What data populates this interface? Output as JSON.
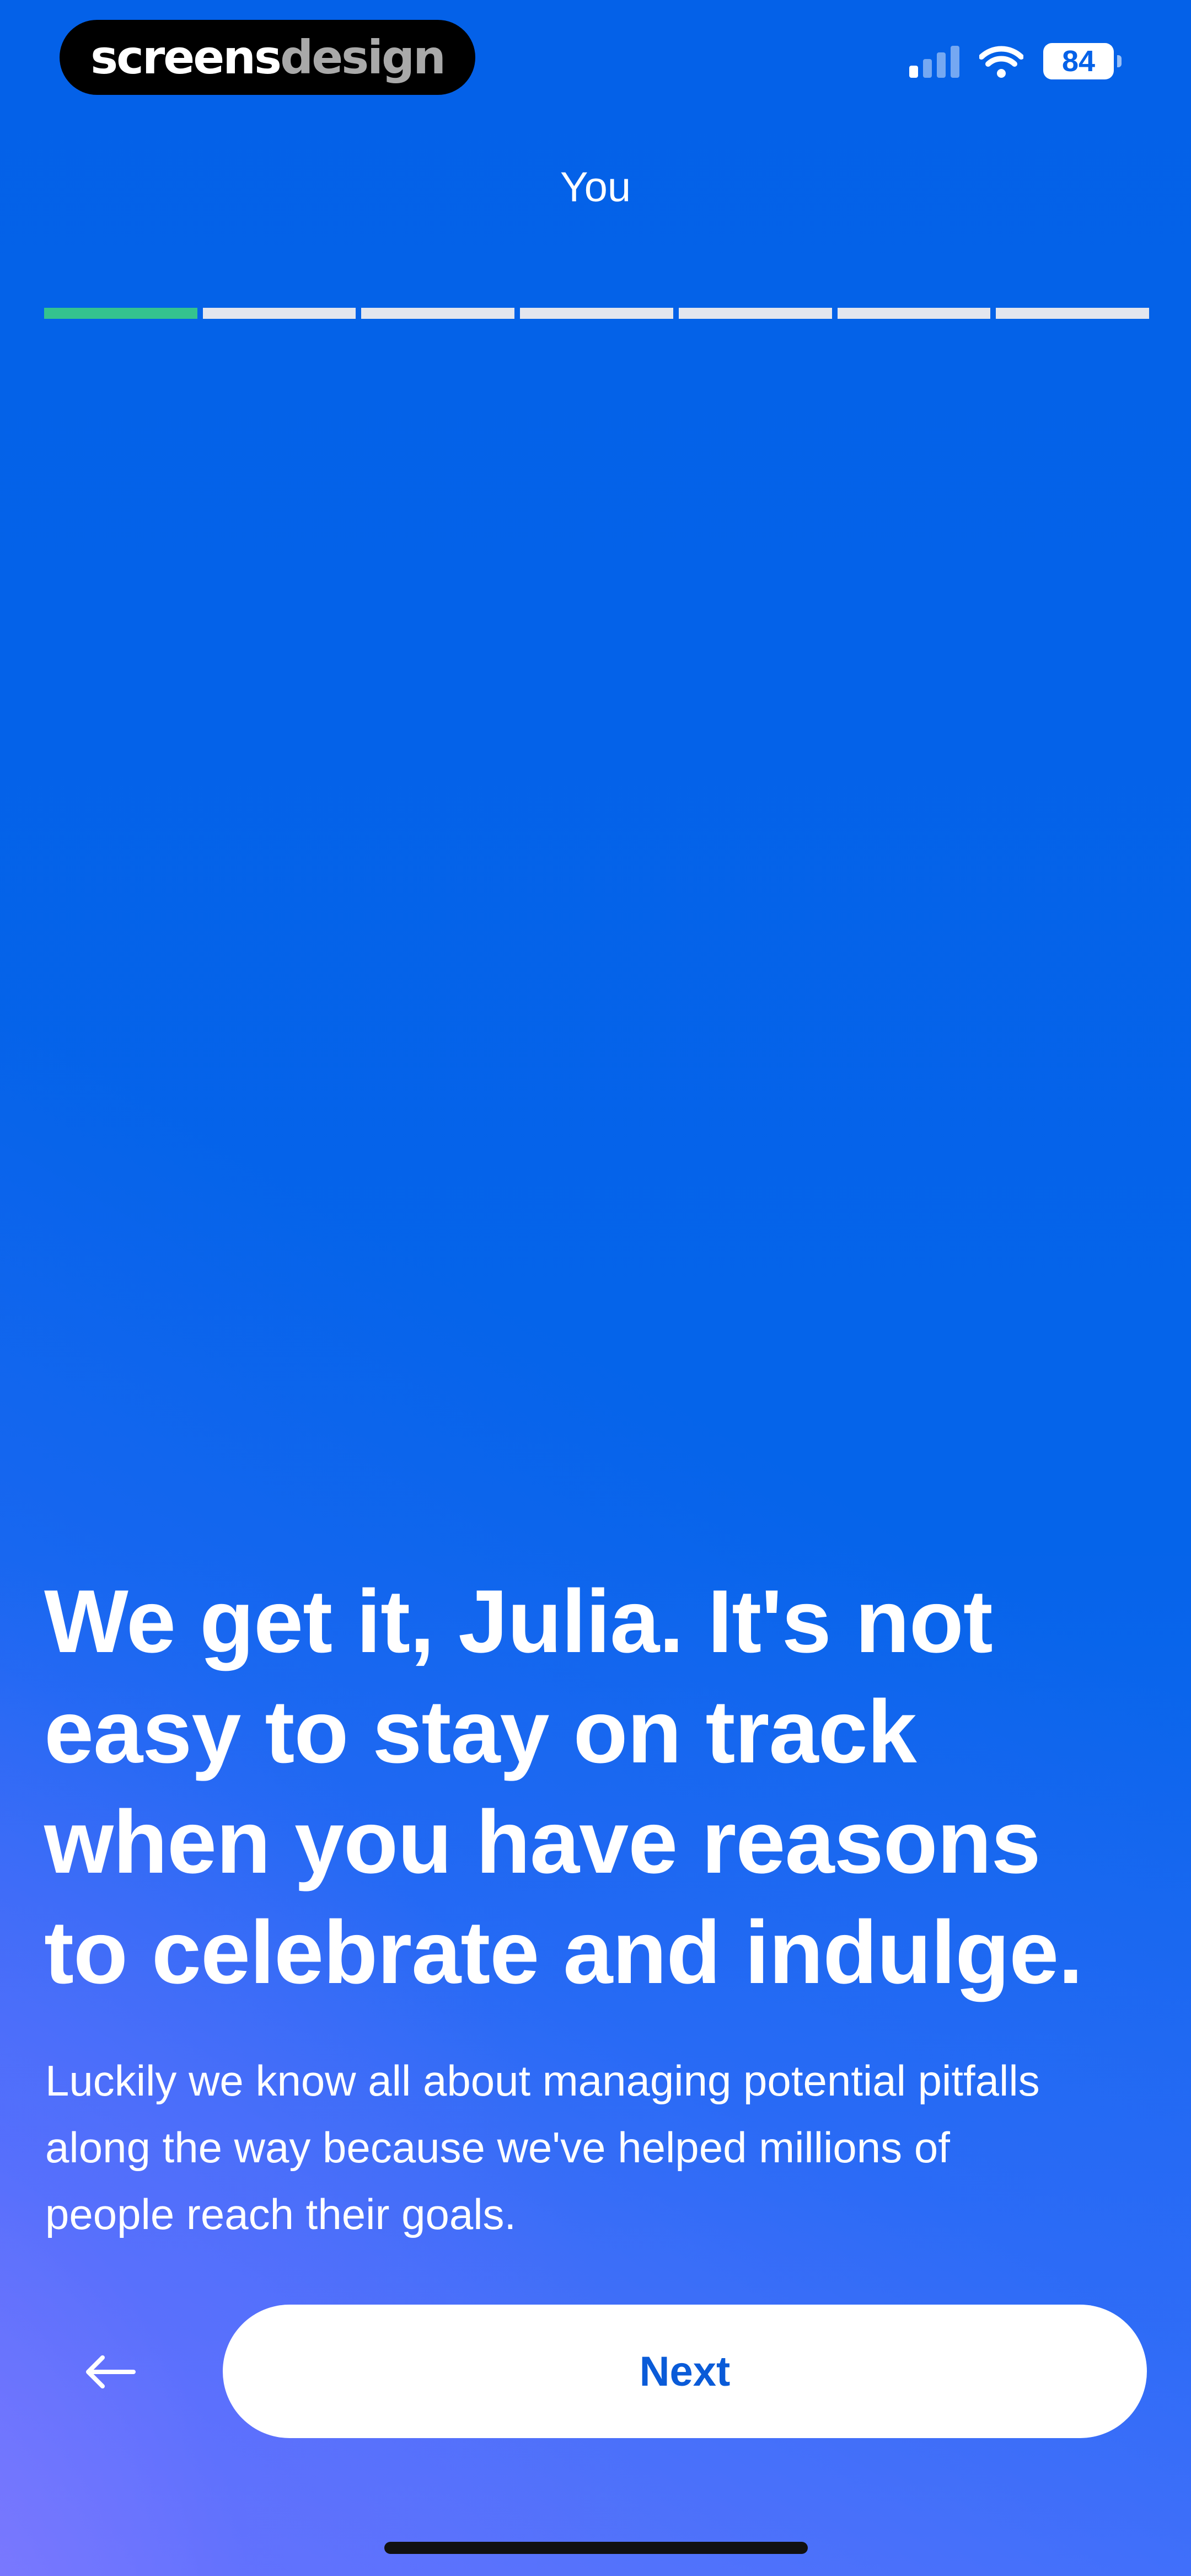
{
  "watermark": {
    "part1": "screens",
    "part2": "design"
  },
  "status_bar": {
    "battery": "84"
  },
  "header": {
    "title": "You"
  },
  "progress": {
    "total_steps": 7,
    "current_step": 1
  },
  "content": {
    "headline_lines": [
      "We get it, Julia. It's not",
      "easy to stay on track",
      "when you have reasons",
      "to celebrate and indulge."
    ],
    "subtext_lines": [
      "Luckily we know all about managing potential pitfalls",
      "along the way because we've helped millions of",
      "people reach their goals."
    ]
  },
  "footer": {
    "back_icon": "arrow-left-icon",
    "next_label": "Next"
  },
  "colors": {
    "background": "#0461E8",
    "progress_active": "#34C38F",
    "progress_inactive": "#E3E6EE",
    "button_bg": "#FFFFFF",
    "button_text": "#0A5BD8"
  }
}
